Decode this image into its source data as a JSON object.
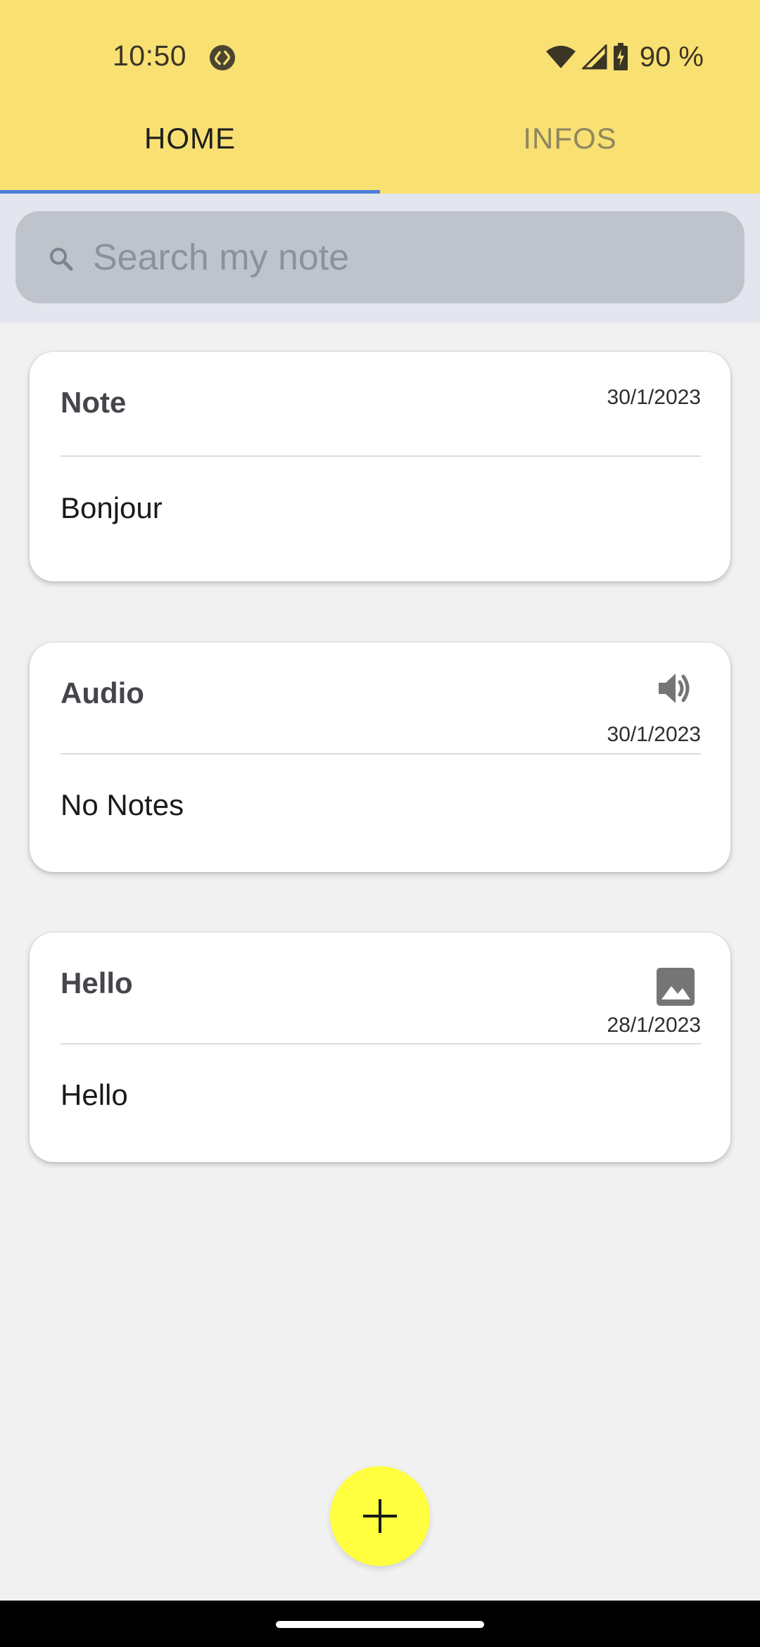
{
  "status_bar": {
    "time": "10:50",
    "battery": "90 %",
    "icons": [
      "shazam-icon",
      "wifi-icon",
      "cellular-signal-icon",
      "battery-charging-icon"
    ]
  },
  "tabs": [
    {
      "label": "HOME",
      "active": true
    },
    {
      "label": "INFOS",
      "active": false
    }
  ],
  "search": {
    "placeholder": "Search my note",
    "value": ""
  },
  "notes": [
    {
      "title": "Note",
      "date": "30/1/2023",
      "body": "Bonjour",
      "icon": null
    },
    {
      "title": "Audio",
      "date": "30/1/2023",
      "body": "No Notes",
      "icon": "volume-icon"
    },
    {
      "title": "Hello",
      "date": "28/1/2023",
      "body": "Hello",
      "icon": "image-icon"
    }
  ],
  "fab": {
    "icon": "plus-icon"
  },
  "colors": {
    "appbar": "#f8e073",
    "tab_indicator": "#4a7fd6",
    "search_bg": "#e3e6ee",
    "search_field": "#bfc4cc",
    "fab": "#ffff40"
  }
}
